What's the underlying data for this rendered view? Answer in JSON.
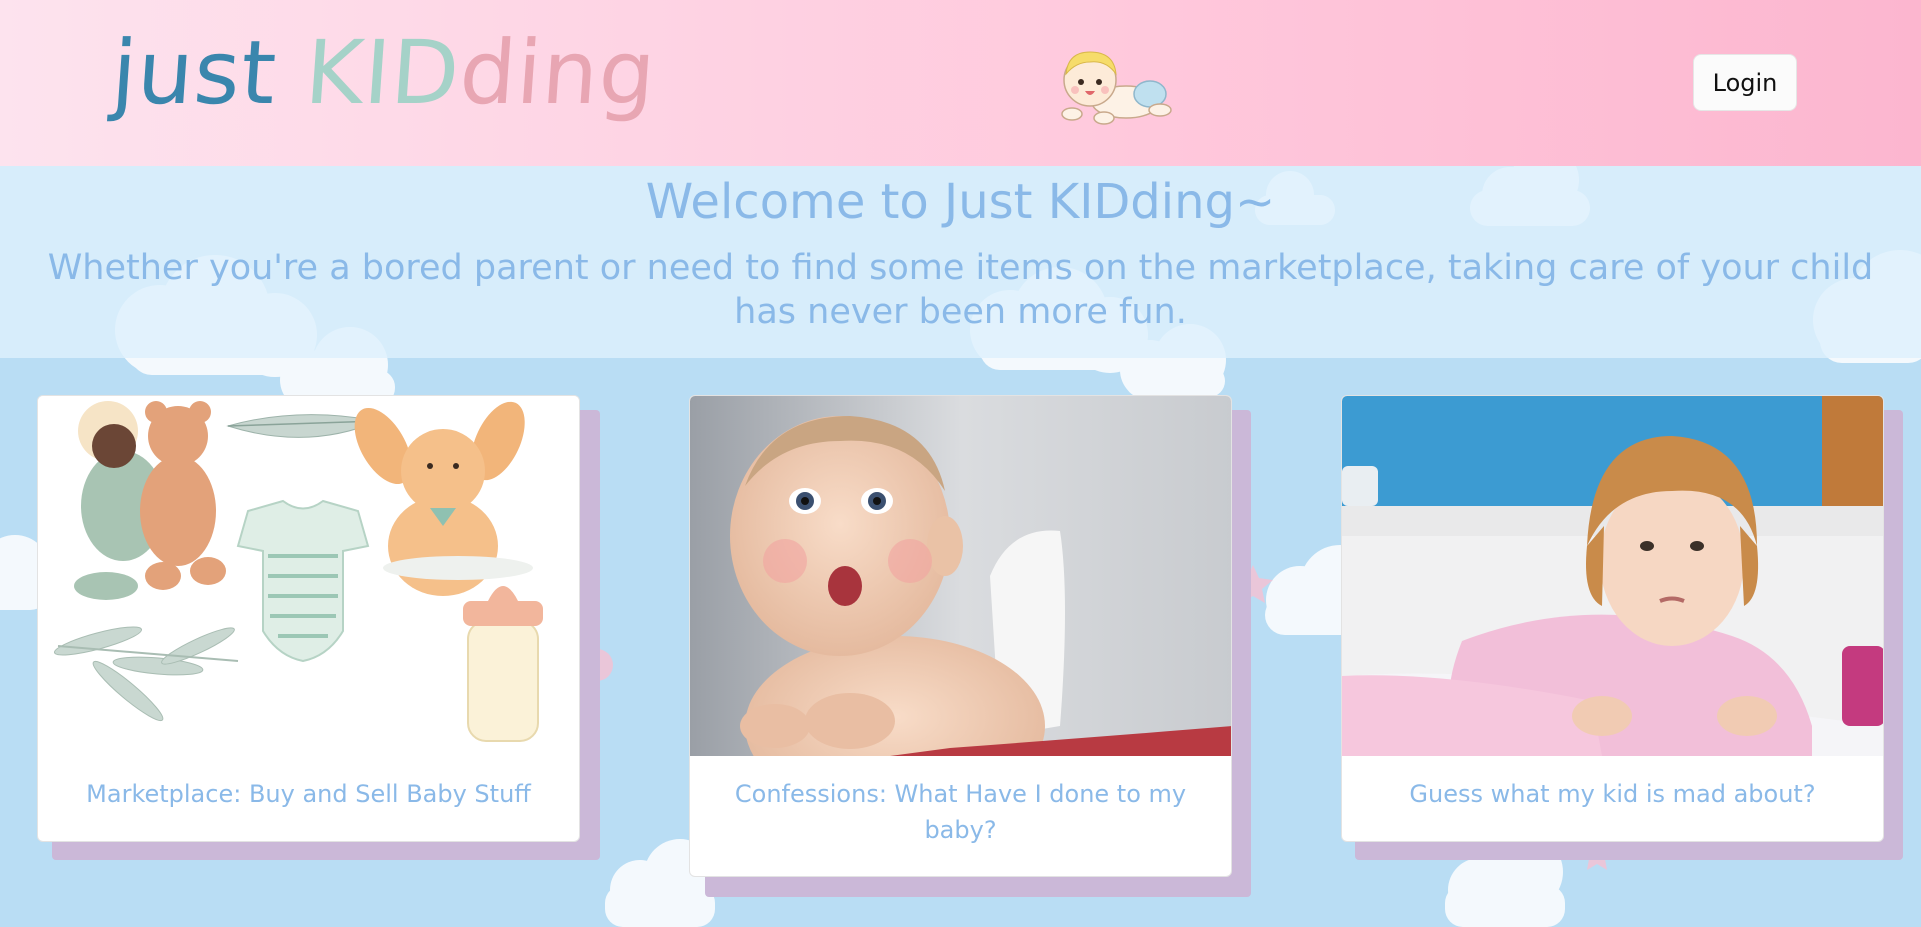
{
  "header": {
    "logo": {
      "part1": "just",
      "part2": "KID",
      "part3": "ding"
    },
    "login_label": "Login"
  },
  "welcome": {
    "title": "Welcome to Just KIDding~",
    "subtitle": "Whether you're a bored parent or need to find some items on the marketplace, taking care of your child has never been more fun."
  },
  "cards": [
    {
      "caption": "Marketplace: Buy and Sell Baby Stuff",
      "image": "baby-items-illustration"
    },
    {
      "caption": "Confessions: What Have I done to my baby?",
      "image": "surprised-baby-photo"
    },
    {
      "caption": "Guess what my kid is mad about?",
      "image": "grumpy-toddler-photo"
    }
  ],
  "colors": {
    "header_gradient_start": "#fde3ee",
    "header_gradient_end": "#fcb6cf",
    "logo_blue": "#3a86ad",
    "logo_green": "#a5d2c8",
    "logo_pink": "#e8a6b3",
    "welcome_text": "#8ab9e8",
    "page_background": "#b9ddf4",
    "card_shadow": "#cbb8d8"
  }
}
